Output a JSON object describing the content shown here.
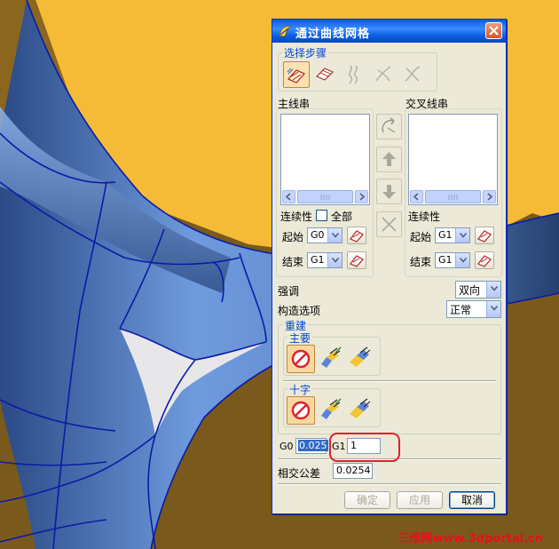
{
  "window": {
    "title": "通过曲线网格"
  },
  "steps": {
    "group_label": "选择步骤"
  },
  "primary": {
    "label": "主线串",
    "continuity_label": "连续性",
    "all_label": "全部",
    "start_label": "起始",
    "start_value": "G0",
    "end_label": "结束",
    "end_value": "G1"
  },
  "cross": {
    "label": "交叉线串",
    "continuity_label": "连续性",
    "start_label": "起始",
    "start_value": "G1",
    "end_label": "结束",
    "end_value": "G1"
  },
  "emphasis": {
    "label": "强调",
    "value": "双向"
  },
  "construction": {
    "label": "构造选项",
    "value": "正常"
  },
  "rebuild": {
    "group_label": "重建",
    "primary_label": "主要",
    "cross_label": "十字"
  },
  "tolerance": {
    "g0_label": "G0",
    "g0_value": "0.025",
    "g1_label": "G1",
    "g1_value": "1",
    "intersect_label": "相交公差",
    "intersect_value": "0.0254"
  },
  "buttons": {
    "ok": "确定",
    "apply": "应用",
    "cancel": "取消"
  },
  "watermark": "三维网www.3dportal.cn",
  "colors": {
    "titlebar": "#0a58e8",
    "surface_blue": "#5b84c6",
    "background_gold": "#f5bb37",
    "highlight_red": "#e0202a"
  }
}
